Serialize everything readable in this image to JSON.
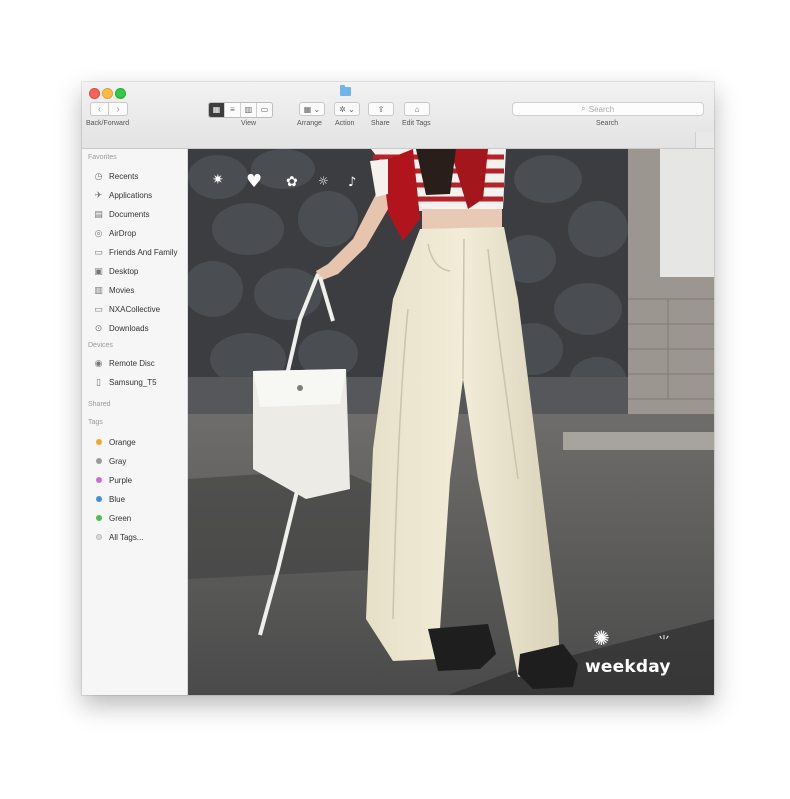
{
  "toolbar": {
    "back_label": "Back/Forward",
    "view_label": "View",
    "arrange_label": "Arrange",
    "action_label": "Action",
    "share_label": "Share",
    "edit_tags_label": "Edit Tags",
    "search_label": "Search",
    "search_placeholder": "Search"
  },
  "sidebar": {
    "favorites_title": "Favorites",
    "favorites": [
      {
        "label": "Recents",
        "icon": "clock-icon"
      },
      {
        "label": "Applications",
        "icon": "applications-icon"
      },
      {
        "label": "Documents",
        "icon": "documents-icon"
      },
      {
        "label": "AirDrop",
        "icon": "airdrop-icon"
      },
      {
        "label": "Friends And Family",
        "icon": "folder-icon"
      },
      {
        "label": "Desktop",
        "icon": "desktop-icon"
      },
      {
        "label": "Movies",
        "icon": "movies-icon"
      },
      {
        "label": "NXACollective",
        "icon": "folder-icon"
      },
      {
        "label": "Downloads",
        "icon": "downloads-icon"
      }
    ],
    "devices_title": "Devices",
    "devices": [
      {
        "label": "Remote Disc",
        "icon": "disc-icon"
      },
      {
        "label": "Samsung_T5",
        "icon": "disk-icon"
      }
    ],
    "shared_title": "Shared",
    "tags_title": "Tags",
    "tags": [
      {
        "label": "Orange",
        "color": "#f5a623"
      },
      {
        "label": "Gray",
        "color": "#9b9b9b"
      },
      {
        "label": "Purple",
        "color": "#c86dd7"
      },
      {
        "label": "Blue",
        "color": "#3d8fe0"
      },
      {
        "label": "Green",
        "color": "#4cc04c"
      },
      {
        "label": "All Tags...",
        "color": "#d8d8d8"
      }
    ]
  },
  "content": {
    "brand": "weekday"
  }
}
